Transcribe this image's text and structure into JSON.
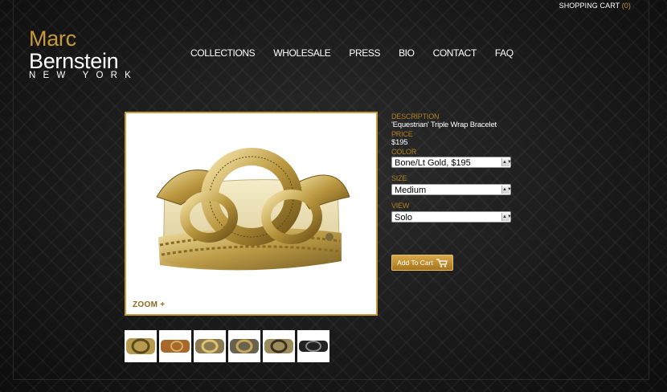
{
  "header": {
    "cart_label": "SHOPPING CART",
    "cart_count": "(0)"
  },
  "logo": {
    "first": "Marc",
    "last": "Bernstein",
    "city": "NEW YORK"
  },
  "nav": [
    {
      "label": "COLLECTIONS"
    },
    {
      "label": "WHOLESALE"
    },
    {
      "label": "PRESS"
    },
    {
      "label": "BIO"
    },
    {
      "label": "CONTACT"
    },
    {
      "label": "FAQ"
    }
  ],
  "product": {
    "zoom_label": "ZOOM +",
    "description_label": "DESCRIPTION",
    "description": "'Equestrian' Triple Wrap Bracelet",
    "price_label": "PRICE",
    "price": "$195",
    "color_label": "COLOR",
    "color_value": "Bone/Lt Gold, $195",
    "size_label": "SIZE",
    "size_value": "Medium",
    "view_label": "VIEW",
    "view_value": "Solo",
    "add_to_cart": "Add To Cart"
  },
  "thumbnails": [
    "thumb-1",
    "thumb-2",
    "thumb-3",
    "thumb-4",
    "thumb-5",
    "thumb-6"
  ],
  "colors": {
    "accent": "#c79a3a",
    "background": "#1a1a1a"
  }
}
